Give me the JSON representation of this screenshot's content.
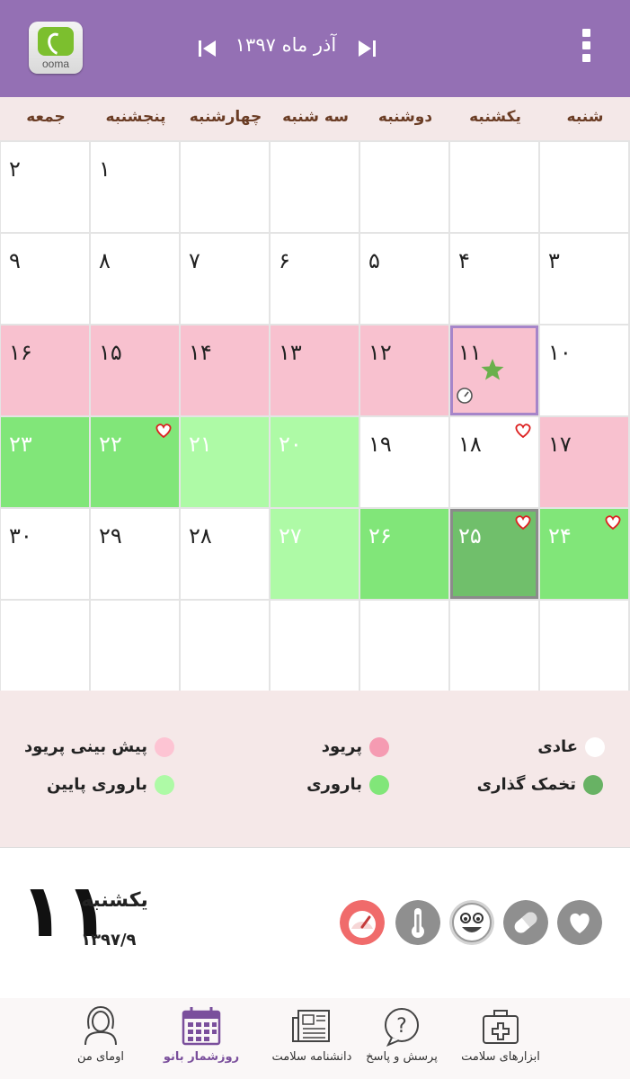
{
  "app": {
    "brand": "ooma"
  },
  "header": {
    "month_title": "آذر ماه ۱۳۹۷",
    "prev_icon": "skip-previous-icon",
    "next_icon": "skip-next-icon",
    "menu_icon": "more-vert-icon"
  },
  "weekdays": [
    "شنبه",
    "یکشنبه",
    "دوشنبه",
    "سه شنبه",
    "چهارشنبه",
    "پنجشنبه",
    "جمعه"
  ],
  "weeks": [
    [
      {
        "d": ""
      },
      {
        "d": ""
      },
      {
        "d": ""
      },
      {
        "d": ""
      },
      {
        "d": ""
      },
      {
        "d": "۱"
      },
      {
        "d": "۲"
      }
    ],
    [
      {
        "d": "۳"
      },
      {
        "d": "۴"
      },
      {
        "d": "۵"
      },
      {
        "d": "۶"
      },
      {
        "d": "۷"
      },
      {
        "d": "۸"
      },
      {
        "d": "۹"
      }
    ],
    [
      {
        "d": "۱۰"
      },
      {
        "d": "۱۱",
        "t": "pink",
        "sel": true,
        "star": true,
        "gauge": true
      },
      {
        "d": "۱۲",
        "t": "pink"
      },
      {
        "d": "۱۳",
        "t": "pink"
      },
      {
        "d": "۱۴",
        "t": "pink"
      },
      {
        "d": "۱۵",
        "t": "pink"
      },
      {
        "d": "۱۶",
        "t": "pink"
      }
    ],
    [
      {
        "d": "۱۷",
        "t": "pink"
      },
      {
        "d": "۱۸",
        "heart": true
      },
      {
        "d": "۱۹"
      },
      {
        "d": "۲۰",
        "t": "light"
      },
      {
        "d": "۲۱",
        "t": "light"
      },
      {
        "d": "۲۲",
        "t": "fert",
        "heart": true
      },
      {
        "d": "۲۳",
        "t": "fert"
      }
    ],
    [
      {
        "d": "۲۴",
        "t": "fert",
        "heart": true
      },
      {
        "d": "۲۵",
        "t": "ovu",
        "sel": true,
        "heart": true
      },
      {
        "d": "۲۶",
        "t": "fert"
      },
      {
        "d": "۲۷",
        "t": "light"
      },
      {
        "d": "۲۸"
      },
      {
        "d": "۲۹"
      },
      {
        "d": "۳۰"
      }
    ],
    [
      {
        "d": ""
      },
      {
        "d": ""
      },
      {
        "d": ""
      },
      {
        "d": ""
      },
      {
        "d": ""
      },
      {
        "d": ""
      },
      {
        "d": ""
      }
    ]
  ],
  "legend": {
    "normal": "عادی",
    "period": "پریود",
    "period_forecast": "پیش بینی پریود",
    "ovulation": "تخمک گذاری",
    "fertile": "باروری",
    "low_fertile": "باروری پایین"
  },
  "colors": {
    "header": "#9470b4",
    "period": "#f8c1cf",
    "light_fertile": "#aefaa6",
    "fertile": "#81e679",
    "ovulation": "#70bf6b",
    "selected_border": "#a685c9"
  },
  "day_panel": {
    "day": "۱۱",
    "weekday": "یکشنبه",
    "date": "۱۳۹۷/۹"
  },
  "tools": [
    "gauge-icon",
    "thermometer-icon",
    "smiley-icon",
    "pill-icon",
    "heart-icon"
  ],
  "nav": {
    "tools": "ابزارهای سلامت",
    "qa": "پرسش و پاسخ",
    "encyclopedia": "دانشنامه سلامت",
    "calendar": "روزشمار بانو",
    "profile": "اومای من"
  }
}
